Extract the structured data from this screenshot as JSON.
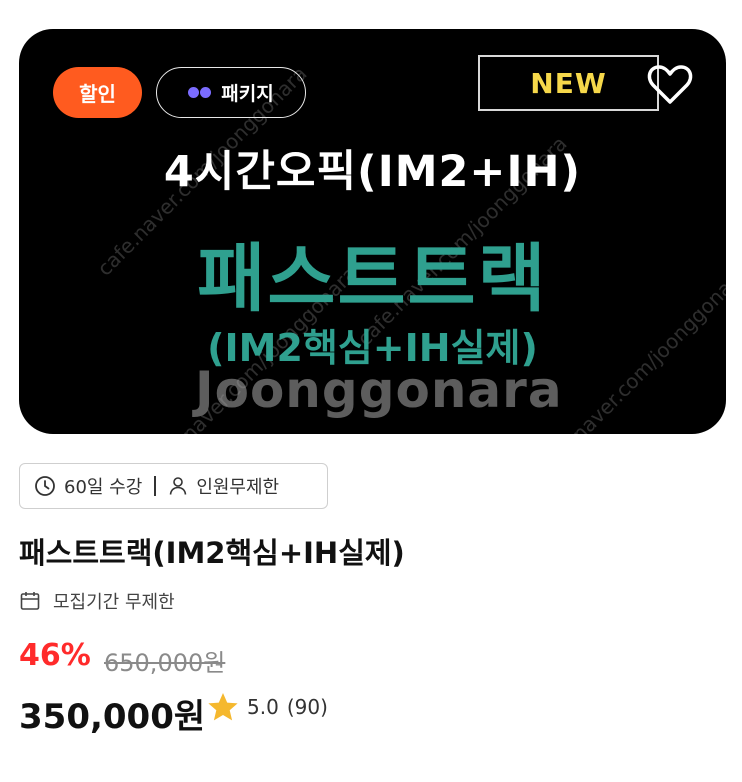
{
  "badges": {
    "sale": "할인",
    "package": "패키지",
    "new": "NEW"
  },
  "banner": {
    "line1": "4시간오픽(IM2+IH)",
    "line2": "패스트트랙",
    "line3": "(IM2핵심+IH실제)",
    "watermark": "Joonggonara",
    "watermark_url": "cafe.naver.com/joonggonara"
  },
  "meta": {
    "duration": "60일 수강",
    "people": "인원무제한"
  },
  "title": "패스트트랙(IM2핵심+IH실제)",
  "recruit_period": "모집기간 무제한",
  "discount_rate": "46%",
  "original_price": "650,000원",
  "price": "350,000원",
  "rating": {
    "score": "5.0",
    "count": "(90)"
  },
  "colors": {
    "sale": "#ff5b1f",
    "accent_teal": "#2fa08f",
    "new_text": "#f6d84a",
    "discount": "#ff2b2b",
    "star": "#f5b82e"
  },
  "icons": [
    "package-icon",
    "heart-icon",
    "clock-icon",
    "person-icon",
    "calendar-icon",
    "star-icon"
  ]
}
